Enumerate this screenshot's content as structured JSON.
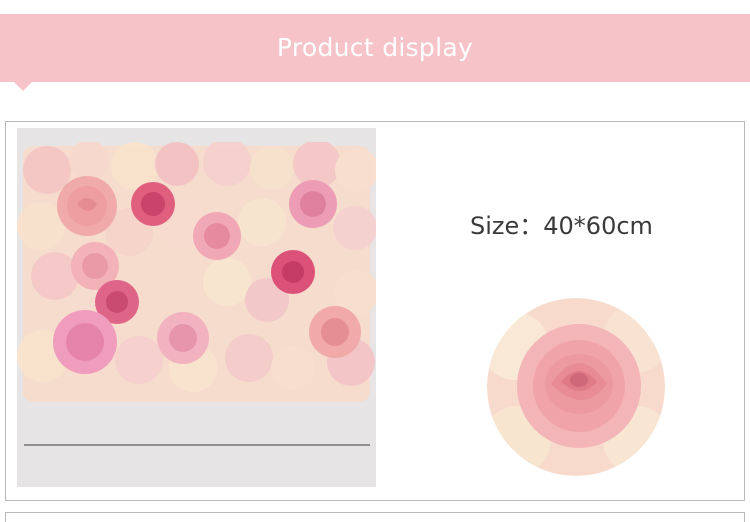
{
  "header": {
    "title": "Product display"
  },
  "product": {
    "size_label": "Size：",
    "size_value": "40*60cm",
    "photo_alt": "Pink and cream artificial rose flower wall panel",
    "detail_alt": "Close-up of a pink silk rose"
  },
  "colors": {
    "banner": "#f6c4c8",
    "panel_border": "#b9b9b9",
    "photo_background": "#e7e4e6",
    "text": "#3a3a3a"
  }
}
